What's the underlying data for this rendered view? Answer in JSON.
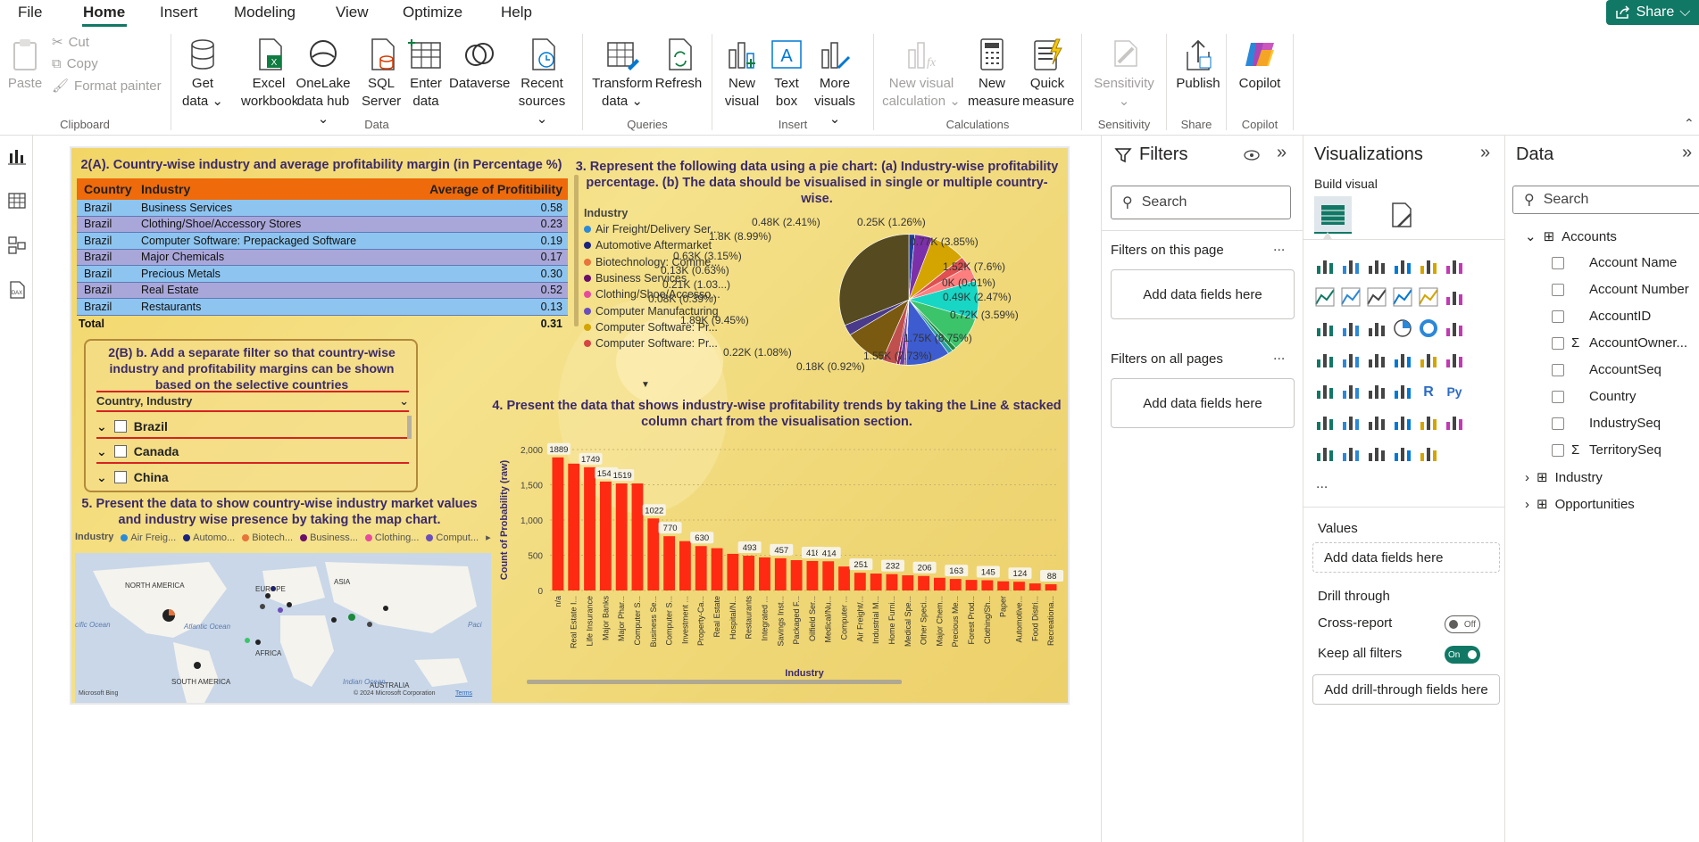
{
  "menu": {
    "items": [
      "File",
      "Home",
      "Insert",
      "Modeling",
      "View",
      "Optimize",
      "Help"
    ],
    "share": "Share"
  },
  "ribbon": {
    "clipboard": {
      "paste": "Paste",
      "cut": "Cut",
      "copy": "Copy",
      "format_painter": "Format painter",
      "label": "Clipboard"
    },
    "data": {
      "get_data": "Get data",
      "excel": "Excel workbook",
      "onelake": "OneLake data hub",
      "sql": "SQL Server",
      "enter": "Enter data",
      "dataverse": "Dataverse",
      "recent": "Recent sources",
      "label": "Data"
    },
    "queries": {
      "transform": "Transform data",
      "refresh": "Refresh",
      "label": "Queries"
    },
    "insert": {
      "new_visual": "New visual",
      "text_box": "Text box",
      "more_visuals": "More visuals",
      "label": "Insert"
    },
    "calculations": {
      "new_visual_calc": "New visual calculation",
      "new_measure": "New measure",
      "quick_measure": "Quick measure",
      "label": "Calculations"
    },
    "sensitivity": {
      "btn": "Sensitivity",
      "label": "Sensitivity"
    },
    "share": {
      "publish": "Publish",
      "label": "Share"
    },
    "copilot": {
      "btn": "Copilot",
      "label": "Copilot"
    }
  },
  "report": {
    "table_title": "2(A). Country-wise industry and average profitability margin (in Percentage %)",
    "table_headers": [
      "Country",
      "Industry",
      "Average of Profitibility"
    ],
    "table_rows": [
      [
        "Brazil",
        "Business Services",
        "0.58"
      ],
      [
        "Brazil",
        "Clothing/Shoe/Accessory Stores",
        "0.23"
      ],
      [
        "Brazil",
        "Computer Software: Prepackaged Software",
        "0.19"
      ],
      [
        "Brazil",
        "Major Chemicals",
        "0.17"
      ],
      [
        "Brazil",
        "Precious Metals",
        "0.30"
      ],
      [
        "Brazil",
        "Real Estate",
        "0.52"
      ],
      [
        "Brazil",
        "Restaurants",
        "0.13"
      ]
    ],
    "table_total": [
      "Total",
      "0.31"
    ],
    "slicer_title": "2(B) b. Add a separate filter so that country-wise industry and profitability margins can be shown based on the selective countries",
    "slicer_header": "Country, Industry",
    "slicer_items": [
      "Brazil",
      "Canada",
      "China"
    ],
    "map_title": "5. Present the data to show country-wise industry market values and industry wise presence by taking the map chart.",
    "map_legend_label": "Industry",
    "map_legend": [
      "Air Freig...",
      "Automo...",
      "Biotech...",
      "Business...",
      "Clothing...",
      "Comput..."
    ],
    "map_labels": [
      "NORTH AMERICA",
      "EUROPE",
      "ASIA",
      "AFRICA",
      "SOUTH AMERICA",
      "AUSTRALIA",
      "Atlantic Ocean",
      "Indian Ocean",
      "cific Ocean",
      "Paci"
    ],
    "map_credit": "Microsoft Bing",
    "map_copyright": "© 2024 Microsoft Corporation",
    "map_terms": "Terms",
    "pie_title": "3. Represent the following data using a pie chart: (a) Industry-wise profitability percentage. (b) The data should be visualised in single or multiple country-wise.",
    "pie_legend_label": "Industry",
    "pie_legend": [
      "Air Freight/Delivery Ser...",
      "Automotive Aftermarket",
      "Biotechnology: Comme...",
      "Business Services",
      "Clothing/Shoe/Accesso...",
      "Computer Manufacturing",
      "Computer Software: Pr...",
      "Computer Software: Pr..."
    ],
    "bar_title": "4. Present the data that shows industry-wise profitability trends by taking the Line & stacked column chart from the visualisation section."
  },
  "colors": {
    "pie_legend": [
      "#2b8bd8",
      "#1a237e",
      "#e8743b",
      "#6a0f6a",
      "#e74c9c",
      "#6b4fbb",
      "#d4a400",
      "#d64545"
    ],
    "bar": "#ff2a12",
    "accent": "#117865"
  },
  "chart_data": [
    {
      "type": "pie",
      "title": "3. Represent the following data using a pie chart: (a) Industry-wise profitability percentage. (b) The data should be visualised in single or multiple country-wise.",
      "slices": [
        {
          "label": "0.25K (1.26%)",
          "value": 1.26,
          "color": "#1f3fa0"
        },
        {
          "label": "0.77K (3.85%)",
          "value": 3.85,
          "color": "#7b2fa8"
        },
        {
          "label": "1.52K (7.6%)",
          "value": 7.6,
          "color": "#d4a400"
        },
        {
          "label": "0K (0.01%)",
          "value": 0.01,
          "color": "#c0392b"
        },
        {
          "label": "0.49K (2.47%)",
          "value": 2.47,
          "color": "#e05050"
        },
        {
          "label": "0.72K (3.59%)",
          "value": 3.59,
          "color": "#ff7f7f"
        },
        {
          "label": "1.75K (8.75%)",
          "value": 8.75,
          "color": "#17d6c4"
        },
        {
          "label": "1.55K (7.73%)",
          "value": 7.73,
          "color": "#3cc46b"
        },
        {
          "label": "0.18K (0.92%)",
          "value": 0.92,
          "color": "#1b8a3a"
        },
        {
          "label": "0.22K (1.08%)",
          "value": 1.08,
          "color": "#2ca0a0"
        },
        {
          "label": "1.89K (9.45%)",
          "value": 9.45,
          "color": "#3d5ccf"
        },
        {
          "label": "0.08K (0.39%)",
          "value": 0.39,
          "color": "#b03070"
        },
        {
          "label": "0.21K (1.03...)",
          "value": 1.03,
          "color": "#6b3fa0"
        },
        {
          "label": "0.13K (0.63%)",
          "value": 0.63,
          "color": "#8a1a5a"
        },
        {
          "label": "0.63K (3.15%)",
          "value": 3.15,
          "color": "#c0504d"
        },
        {
          "label": "1.8K (8.99%)",
          "value": 8.99,
          "color": "#7a5a10"
        },
        {
          "label": "0.48K (2.41%)",
          "value": 2.41,
          "color": "#4a3a8a"
        },
        {
          "label": "",
          "value": 28.99,
          "color": "#554a20"
        }
      ]
    },
    {
      "type": "bar",
      "title": "4. Present the data that shows industry-wise profitability trends by taking the Line & stacked column chart from the visualisation section.",
      "xlabel": "Industry",
      "ylabel": "Count of Probability (raw)",
      "ylim": [
        0,
        2000
      ],
      "yticks": [
        "0",
        "500",
        "1,000",
        "1,500",
        "2,000"
      ],
      "categories": [
        "n/a",
        "Real Estate I...",
        "Life Insurance",
        "Major Banks",
        "Major Phar...",
        "Computer S...",
        "Business Se...",
        "Computer S...",
        "Investment ...",
        "Property-Ca...",
        "Real Estate",
        "Hospital/N...",
        "Restaurants",
        "Integrated ...",
        "Savings Inst...",
        "Packaged F...",
        "Oilfield Ser...",
        "Medical/Nu...",
        "Computer ...",
        "Air Freight/...",
        "Industrial M...",
        "Home Furni...",
        "Medical Spe...",
        "Other Speci...",
        "Major Chem...",
        "Precious Me...",
        "Forest Prod...",
        "Clothing/Sh...",
        "Paper",
        "Automotive...",
        "Food Distri...",
        "Recreationa..."
      ],
      "values": [
        1889,
        1800,
        1749,
        1546,
        1519,
        1519,
        1022,
        770,
        700,
        630,
        600,
        520,
        493,
        470,
        457,
        430,
        418,
        414,
        340,
        251,
        240,
        232,
        215,
        206,
        180,
        163,
        150,
        145,
        130,
        124,
        100,
        88
      ],
      "data_labels": [
        1889,
        1749,
        1546,
        1519,
        1022,
        770,
        630,
        493,
        457,
        418,
        414,
        251,
        232,
        206,
        163,
        145,
        124,
        88
      ]
    }
  ],
  "filters": {
    "title": "Filters",
    "search": "Search",
    "this_page": "Filters on this page",
    "add_fields": "Add data fields here",
    "all_pages": "Filters on all pages",
    "add_fields2": "Add data fields here",
    "more": "..."
  },
  "viz": {
    "title": "Visualizations",
    "build": "Build visual",
    "values": "Values",
    "add_values": "Add data fields here",
    "drill": "Drill through",
    "cross": "Cross-report",
    "cross_state": "Off",
    "keep": "Keep all filters",
    "keep_state": "On",
    "add_drill": "Add drill-through fields here",
    "more": "..."
  },
  "data_pane": {
    "title": "Data",
    "search": "Search",
    "tables": [
      {
        "name": "Accounts",
        "fields": [
          "Account Name",
          "Account Number",
          "AccountID",
          "AccountOwner...",
          "AccountSeq",
          "Country",
          "IndustrySeq",
          "TerritorySeq"
        ]
      },
      {
        "name": "Industry"
      },
      {
        "name": "Opportunities"
      }
    ],
    "sigma": "Σ"
  }
}
